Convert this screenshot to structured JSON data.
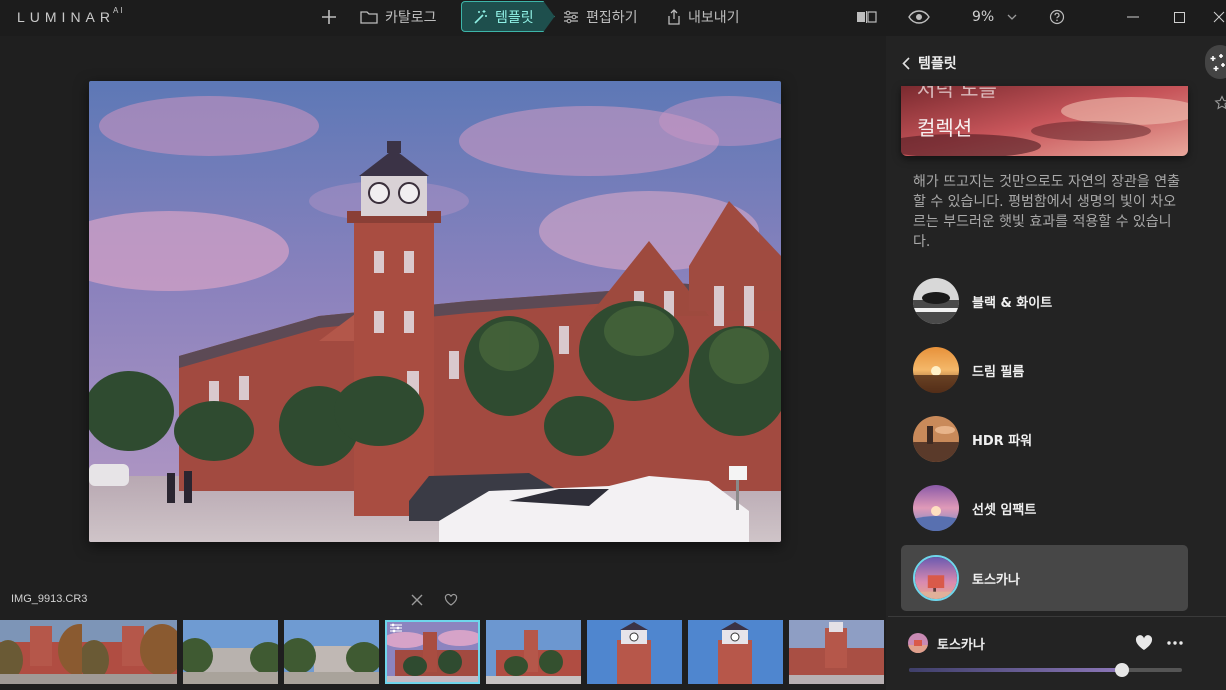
{
  "app": {
    "logo": "LUMINAR",
    "logo_sup": "AI"
  },
  "toolbar": {
    "catalog": "카탈로그",
    "templates": "템플릿",
    "edit": "편집하기",
    "export": "내보내기",
    "zoom": "9%"
  },
  "filmstrip": {
    "filename": "IMG_9913.CR3",
    "selected_index": 4,
    "thumb_count": 9
  },
  "panel": {
    "back_label": "템플릿",
    "collection_title_line1": "저녁 노을",
    "collection_title_line2": "컬렉션",
    "description": "해가 뜨고지는 것만으로도 자연의 장관을 연출할 수 있습니다. 평범함에서 생명의 빛이 차오르는 부드러운 햇빛 효과를 적용할 수 있습니다.",
    "presets": [
      {
        "label": "블랙 & 화이트"
      },
      {
        "label": "드림 필름"
      },
      {
        "label": "HDR 파워"
      },
      {
        "label": "선셋 임팩트"
      },
      {
        "label": "토스카나"
      }
    ],
    "active_preset": "토스카나",
    "amount_fraction": 0.78
  },
  "colors": {
    "accent": "#6fd6ec",
    "template_tab": "#1e4f4d"
  }
}
